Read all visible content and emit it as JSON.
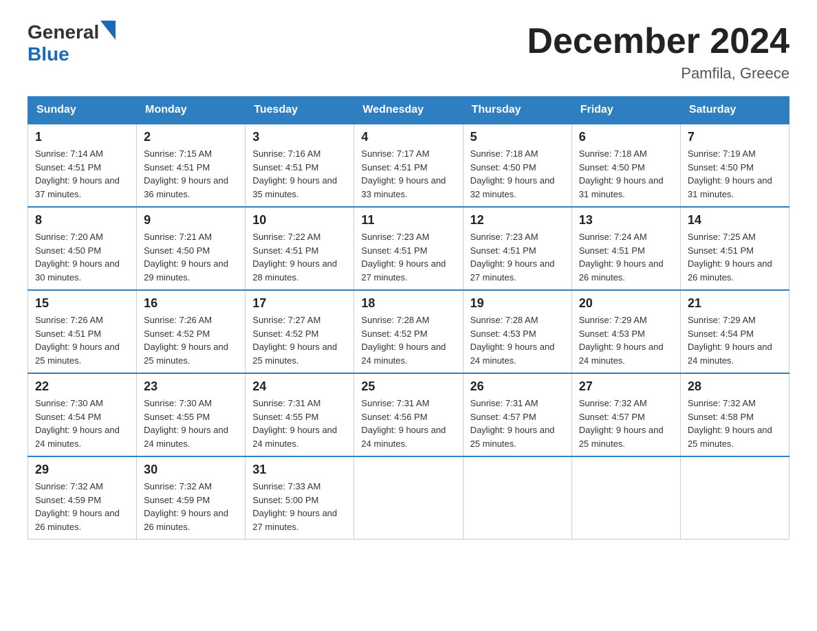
{
  "header": {
    "logo_general": "General",
    "logo_blue": "Blue",
    "month_title": "December 2024",
    "location": "Pamfila, Greece"
  },
  "weekdays": [
    "Sunday",
    "Monday",
    "Tuesday",
    "Wednesday",
    "Thursday",
    "Friday",
    "Saturday"
  ],
  "weeks": [
    [
      {
        "day": "1",
        "sunrise": "7:14 AM",
        "sunset": "4:51 PM",
        "daylight": "9 hours and 37 minutes."
      },
      {
        "day": "2",
        "sunrise": "7:15 AM",
        "sunset": "4:51 PM",
        "daylight": "9 hours and 36 minutes."
      },
      {
        "day": "3",
        "sunrise": "7:16 AM",
        "sunset": "4:51 PM",
        "daylight": "9 hours and 35 minutes."
      },
      {
        "day": "4",
        "sunrise": "7:17 AM",
        "sunset": "4:51 PM",
        "daylight": "9 hours and 33 minutes."
      },
      {
        "day": "5",
        "sunrise": "7:18 AM",
        "sunset": "4:50 PM",
        "daylight": "9 hours and 32 minutes."
      },
      {
        "day": "6",
        "sunrise": "7:18 AM",
        "sunset": "4:50 PM",
        "daylight": "9 hours and 31 minutes."
      },
      {
        "day": "7",
        "sunrise": "7:19 AM",
        "sunset": "4:50 PM",
        "daylight": "9 hours and 31 minutes."
      }
    ],
    [
      {
        "day": "8",
        "sunrise": "7:20 AM",
        "sunset": "4:50 PM",
        "daylight": "9 hours and 30 minutes."
      },
      {
        "day": "9",
        "sunrise": "7:21 AM",
        "sunset": "4:50 PM",
        "daylight": "9 hours and 29 minutes."
      },
      {
        "day": "10",
        "sunrise": "7:22 AM",
        "sunset": "4:51 PM",
        "daylight": "9 hours and 28 minutes."
      },
      {
        "day": "11",
        "sunrise": "7:23 AM",
        "sunset": "4:51 PM",
        "daylight": "9 hours and 27 minutes."
      },
      {
        "day": "12",
        "sunrise": "7:23 AM",
        "sunset": "4:51 PM",
        "daylight": "9 hours and 27 minutes."
      },
      {
        "day": "13",
        "sunrise": "7:24 AM",
        "sunset": "4:51 PM",
        "daylight": "9 hours and 26 minutes."
      },
      {
        "day": "14",
        "sunrise": "7:25 AM",
        "sunset": "4:51 PM",
        "daylight": "9 hours and 26 minutes."
      }
    ],
    [
      {
        "day": "15",
        "sunrise": "7:26 AM",
        "sunset": "4:51 PM",
        "daylight": "9 hours and 25 minutes."
      },
      {
        "day": "16",
        "sunrise": "7:26 AM",
        "sunset": "4:52 PM",
        "daylight": "9 hours and 25 minutes."
      },
      {
        "day": "17",
        "sunrise": "7:27 AM",
        "sunset": "4:52 PM",
        "daylight": "9 hours and 25 minutes."
      },
      {
        "day": "18",
        "sunrise": "7:28 AM",
        "sunset": "4:52 PM",
        "daylight": "9 hours and 24 minutes."
      },
      {
        "day": "19",
        "sunrise": "7:28 AM",
        "sunset": "4:53 PM",
        "daylight": "9 hours and 24 minutes."
      },
      {
        "day": "20",
        "sunrise": "7:29 AM",
        "sunset": "4:53 PM",
        "daylight": "9 hours and 24 minutes."
      },
      {
        "day": "21",
        "sunrise": "7:29 AM",
        "sunset": "4:54 PM",
        "daylight": "9 hours and 24 minutes."
      }
    ],
    [
      {
        "day": "22",
        "sunrise": "7:30 AM",
        "sunset": "4:54 PM",
        "daylight": "9 hours and 24 minutes."
      },
      {
        "day": "23",
        "sunrise": "7:30 AM",
        "sunset": "4:55 PM",
        "daylight": "9 hours and 24 minutes."
      },
      {
        "day": "24",
        "sunrise": "7:31 AM",
        "sunset": "4:55 PM",
        "daylight": "9 hours and 24 minutes."
      },
      {
        "day": "25",
        "sunrise": "7:31 AM",
        "sunset": "4:56 PM",
        "daylight": "9 hours and 24 minutes."
      },
      {
        "day": "26",
        "sunrise": "7:31 AM",
        "sunset": "4:57 PM",
        "daylight": "9 hours and 25 minutes."
      },
      {
        "day": "27",
        "sunrise": "7:32 AM",
        "sunset": "4:57 PM",
        "daylight": "9 hours and 25 minutes."
      },
      {
        "day": "28",
        "sunrise": "7:32 AM",
        "sunset": "4:58 PM",
        "daylight": "9 hours and 25 minutes."
      }
    ],
    [
      {
        "day": "29",
        "sunrise": "7:32 AM",
        "sunset": "4:59 PM",
        "daylight": "9 hours and 26 minutes."
      },
      {
        "day": "30",
        "sunrise": "7:32 AM",
        "sunset": "4:59 PM",
        "daylight": "9 hours and 26 minutes."
      },
      {
        "day": "31",
        "sunrise": "7:33 AM",
        "sunset": "5:00 PM",
        "daylight": "9 hours and 27 minutes."
      },
      null,
      null,
      null,
      null
    ]
  ]
}
